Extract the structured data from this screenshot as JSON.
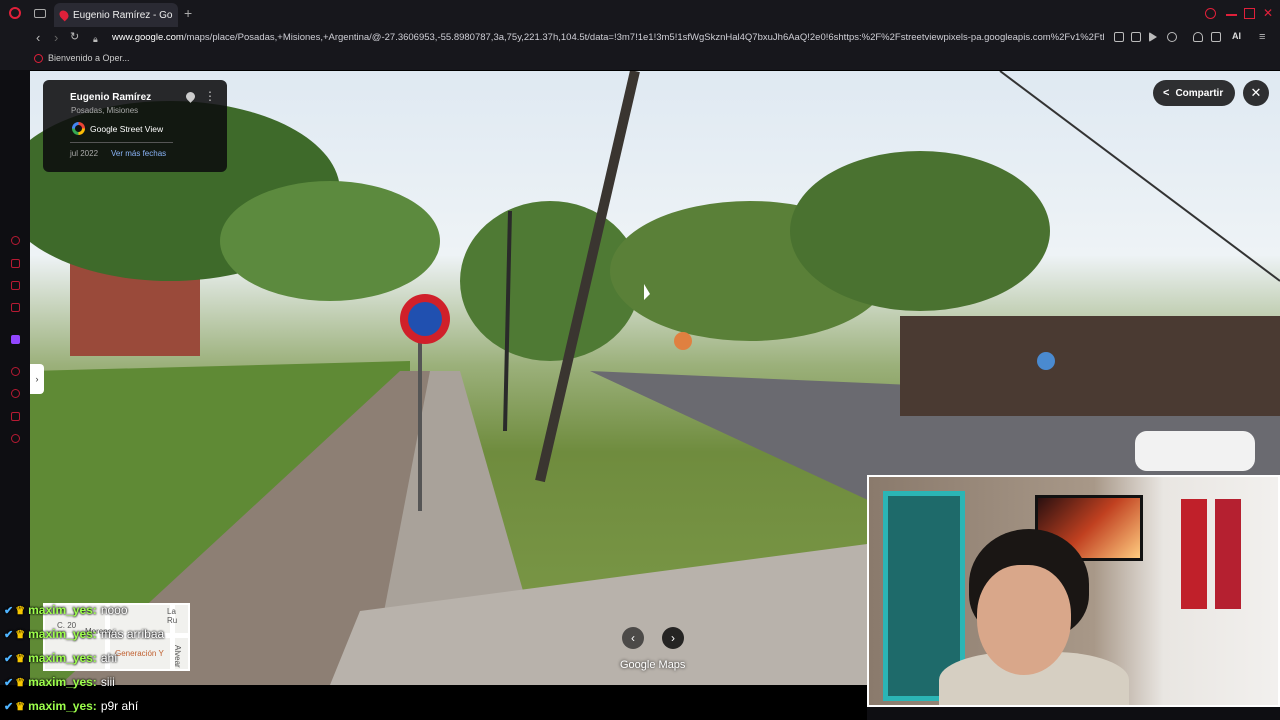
{
  "browser": {
    "tab_title": "Eugenio Ramírez - Google",
    "new_tab": "+",
    "url_domain": "www.google.com",
    "url_path": "/maps/place/Posadas,+Misiones,+Argentina/@-27.3606953,-55.8980787,3a,75y,221.37h,104.5t/data=!3m7!1e1!3m5!1sfWgSkznHal4Q7bxuJh6AaQ!2e0!6shttps:%2F%2Fstreetviewpixels-pa.googleapis.com%2Fv1%2Fthumbn",
    "ai_label": "AI",
    "bookmark": "Bienvenido a Oper..."
  },
  "streetview": {
    "place_title": "Eugenio Ramírez",
    "place_subtitle": "Posadas, Misiones",
    "provider": "Google Street View",
    "date": "jul 2022",
    "more_dates": "Ver más fechas",
    "share_label": "Compartir",
    "close": "✕",
    "expand": "›",
    "prev": "‹",
    "next": "›",
    "watermark": "Google Maps",
    "minimap_labels": [
      "La Ru",
      "Generación Y",
      "C. 20",
      "Moreno",
      "Alvear"
    ]
  },
  "chat": [
    {
      "user": "maxim_yes:",
      "text": "nooo"
    },
    {
      "user": "maxim_yes:",
      "text": "más arribaa"
    },
    {
      "user": "maxim_yes:",
      "text": "ahí"
    },
    {
      "user": "maxim_yes:",
      "text": "siii"
    },
    {
      "user": "maxim_yes:",
      "text": "p9r ahí"
    }
  ],
  "colors": {
    "accent": "#e0203a",
    "chat_user": "#9dff4c",
    "link": "#8ab4f8"
  }
}
